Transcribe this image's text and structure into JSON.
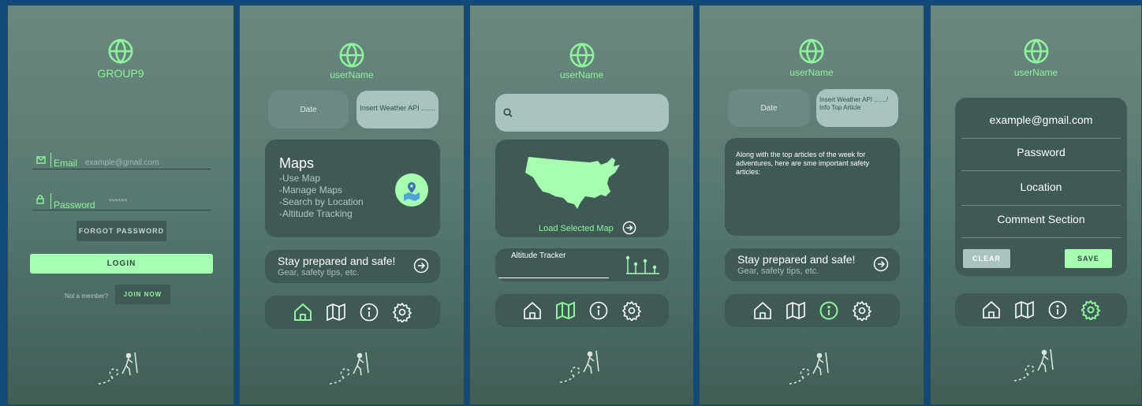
{
  "login": {
    "title": "GROUP9",
    "email_label": "Email",
    "email_placeholder": "example@gmail.com",
    "password_label": "Password",
    "password_placeholder": "******",
    "forgot_label": "FORGOT PASSWORD",
    "login_label": "LOGIN",
    "not_member": "Not a member?",
    "join_label": "JOIN NOW"
  },
  "home": {
    "username": "userName",
    "date_label": "Date",
    "weather_label": "Insert Weather API .......",
    "maps_title": "Maps",
    "maps_items": [
      "-Use Map",
      "-Manage Maps",
      "-Search by Location",
      "-Altitude Tracking"
    ],
    "safe_title": "Stay prepared and safe!",
    "safe_sub": "Gear, safety tips, etc."
  },
  "map": {
    "username": "userName",
    "search_placeholder": "",
    "load_label": "Load Selected Map",
    "altitude_label": "Altitude Tracker"
  },
  "info": {
    "username": "userName",
    "date_label": "Date",
    "weather_label": "Insert Weather API ......./ Info Top Article",
    "article_text": "Along with the top articles of the week for adventures, here are sme important safety articles:",
    "safe_title": "Stay prepared and safe!",
    "safe_sub": "Gear, safety tips, etc."
  },
  "settings": {
    "username": "userName",
    "fields": [
      "example@gmail.com",
      "Password",
      "Location",
      "Comment Section"
    ],
    "clear_label": "CLEAR",
    "save_label": "SAVE"
  },
  "colors": {
    "accent": "#8ef59a",
    "card": "#3f5a54",
    "pill": "#a9c4c0"
  },
  "icons": [
    "globe-icon",
    "mail-icon",
    "lock-icon",
    "location-pin-icon",
    "arrow-right-icon",
    "search-icon",
    "home-icon",
    "map-icon",
    "info-icon",
    "gear-icon",
    "hiker-icon",
    "usa-map-icon",
    "altitude-chart-icon"
  ]
}
